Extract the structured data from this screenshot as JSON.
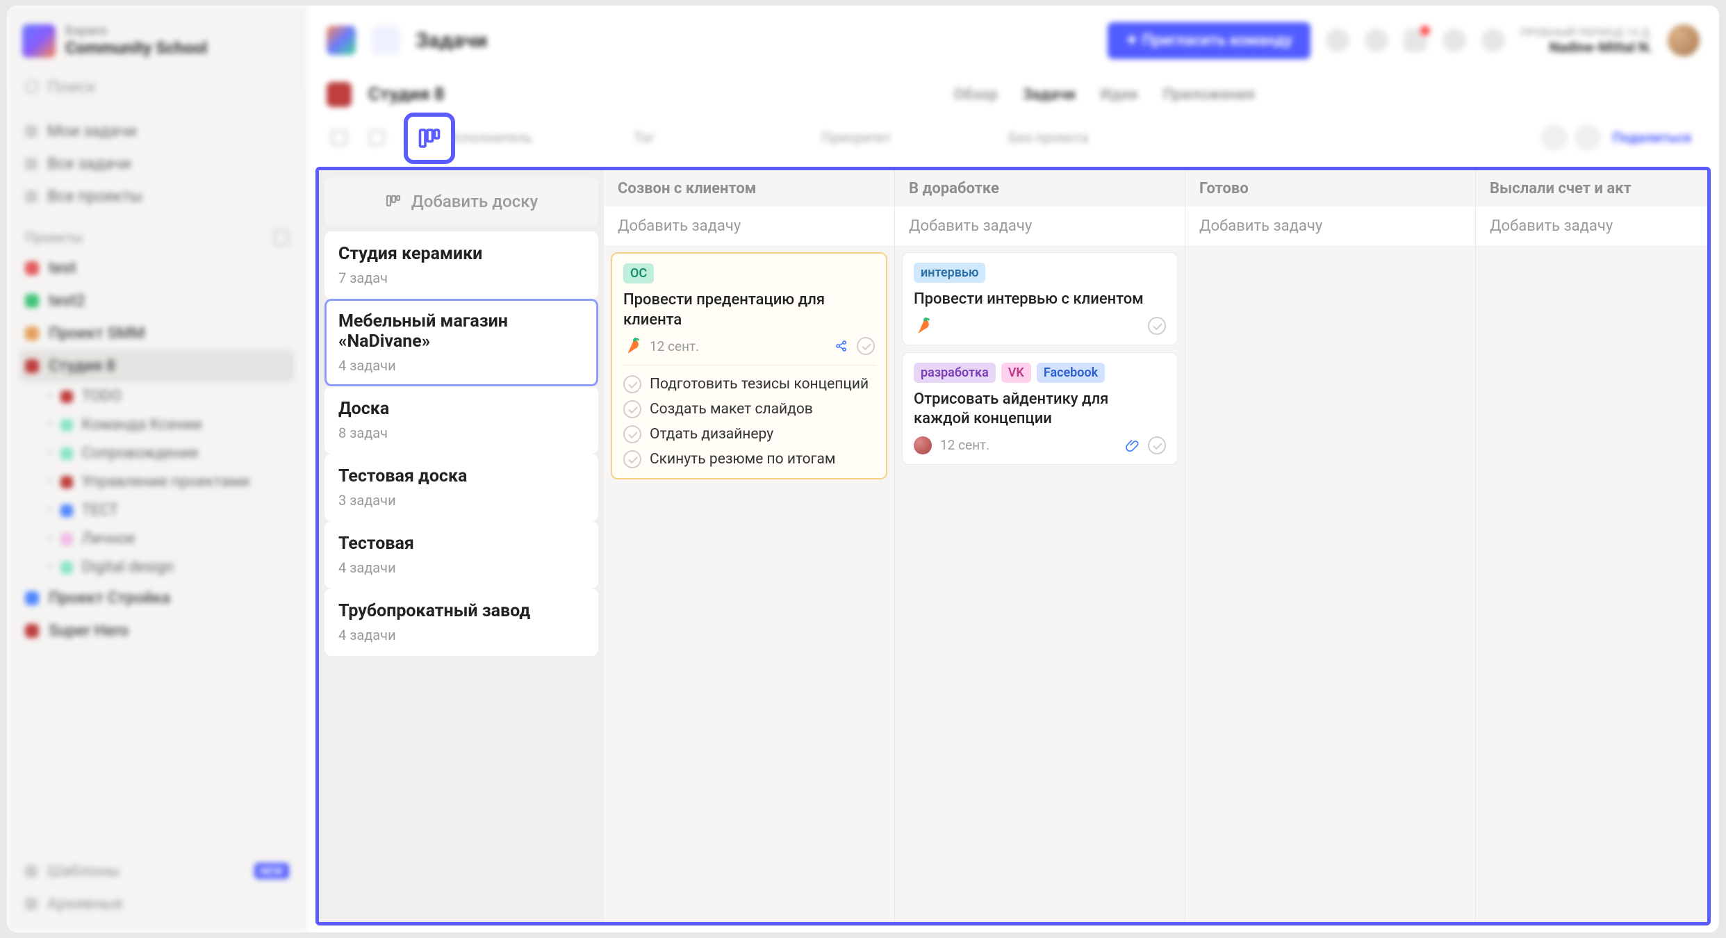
{
  "workspace": {
    "sub": "Бэрапэ",
    "title": "Community School"
  },
  "search": {
    "placeholder": "Поиск"
  },
  "nav": {
    "my_tasks": "Мои задачи",
    "all_tasks": "Все задачи",
    "all_projects": "Все проекты"
  },
  "projects_header": "Проекты",
  "projects": [
    {
      "name": "test",
      "color": "#e24b4b"
    },
    {
      "name": "test2",
      "color": "#2bbd6b"
    },
    {
      "name": "Проект SMM",
      "color": "#e2964b"
    },
    {
      "name": "Студия 8",
      "color": "#b92a2a",
      "active": true
    },
    {
      "name": "Проект Стройка",
      "color": "#3e7bff"
    },
    {
      "name": "Super Hero",
      "color": "#b92a2a"
    }
  ],
  "sub_projects": [
    {
      "name": "TODO",
      "color": "#b92a2a"
    },
    {
      "name": "Команда Ксении",
      "color": "#7de2c3"
    },
    {
      "name": "Сопровождение",
      "color": "#7de2c3"
    },
    {
      "name": "Управление проектами",
      "color": "#b92a2a"
    },
    {
      "name": "ТЕСТ",
      "color": "#3e7bff"
    },
    {
      "name": "Личное",
      "color": "#efb3e6"
    },
    {
      "name": "Digital design",
      "color": "#7de2c3"
    }
  ],
  "sidebar_footer": {
    "templates": "Шаблоны",
    "templates_badge": "NEW",
    "archived": "Архивные"
  },
  "topbar": {
    "title": "Задачи",
    "invite": "Пригласить команду",
    "trial_note": "ПРОБНЫЙ ПЕРИОД 14 Д.",
    "username": "Nadine-Mittal N."
  },
  "project_header": {
    "name": "Студия 8",
    "tabs": [
      "Обзор",
      "Задачи",
      "Идеи",
      "Приложения"
    ],
    "active_tab": 1
  },
  "filters": {
    "executor": "Исполнитель",
    "tag": "Тэг",
    "priority": "Приоритет",
    "no_project": "Без проекта",
    "share": "Поделиться"
  },
  "boards_panel": {
    "add_board": "Добавить доску",
    "boards": [
      {
        "title": "Студия керамики",
        "count": "7 задач"
      },
      {
        "title": "Мебельный магазин «NaDivane»",
        "count": "4 задачи",
        "selected": true
      },
      {
        "title": "Доска",
        "count": "8 задач"
      },
      {
        "title": "Тестовая доска",
        "count": "3 задачи"
      },
      {
        "title": "Тестовая",
        "count": "4 задачи"
      },
      {
        "title": "Трубопрокатный завод",
        "count": "4 задачи"
      }
    ]
  },
  "columns": [
    {
      "name": "Созвон с клиентом",
      "add": "Добавить задачу",
      "cards": [
        {
          "highlight": true,
          "tags": [
            {
              "cls": "t-oc",
              "text": "ОС"
            }
          ],
          "title": "Провести предентацию для клиента",
          "carrot": true,
          "date": "12 сент.",
          "share": true,
          "check": true,
          "subtasks": [
            "Подготовить тезисы концепций",
            "Создать макет слайдов",
            "Отдать дизайнеру",
            "Скинуть резюме по итогам"
          ]
        }
      ]
    },
    {
      "name": "В доработке",
      "add": "Добавить задачу",
      "cards": [
        {
          "tags": [
            {
              "cls": "t-int",
              "text": "интервью"
            }
          ],
          "title": "Провести интервью с клиентом",
          "carrot": true,
          "check": true
        },
        {
          "tags": [
            {
              "cls": "t-dev",
              "text": "разработка"
            },
            {
              "cls": "t-vk",
              "text": "VK"
            },
            {
              "cls": "t-fb",
              "text": "Facebook"
            }
          ],
          "title": "Отрисовать айдентику для каждой концепции",
          "avatar": true,
          "date": "12 сент.",
          "clip": true,
          "check": true
        }
      ]
    },
    {
      "name": "Готово",
      "add": "Добавить задачу",
      "cards": []
    },
    {
      "name": "Выслали счет и акт",
      "add": "Добавить задачу",
      "cards": []
    }
  ]
}
